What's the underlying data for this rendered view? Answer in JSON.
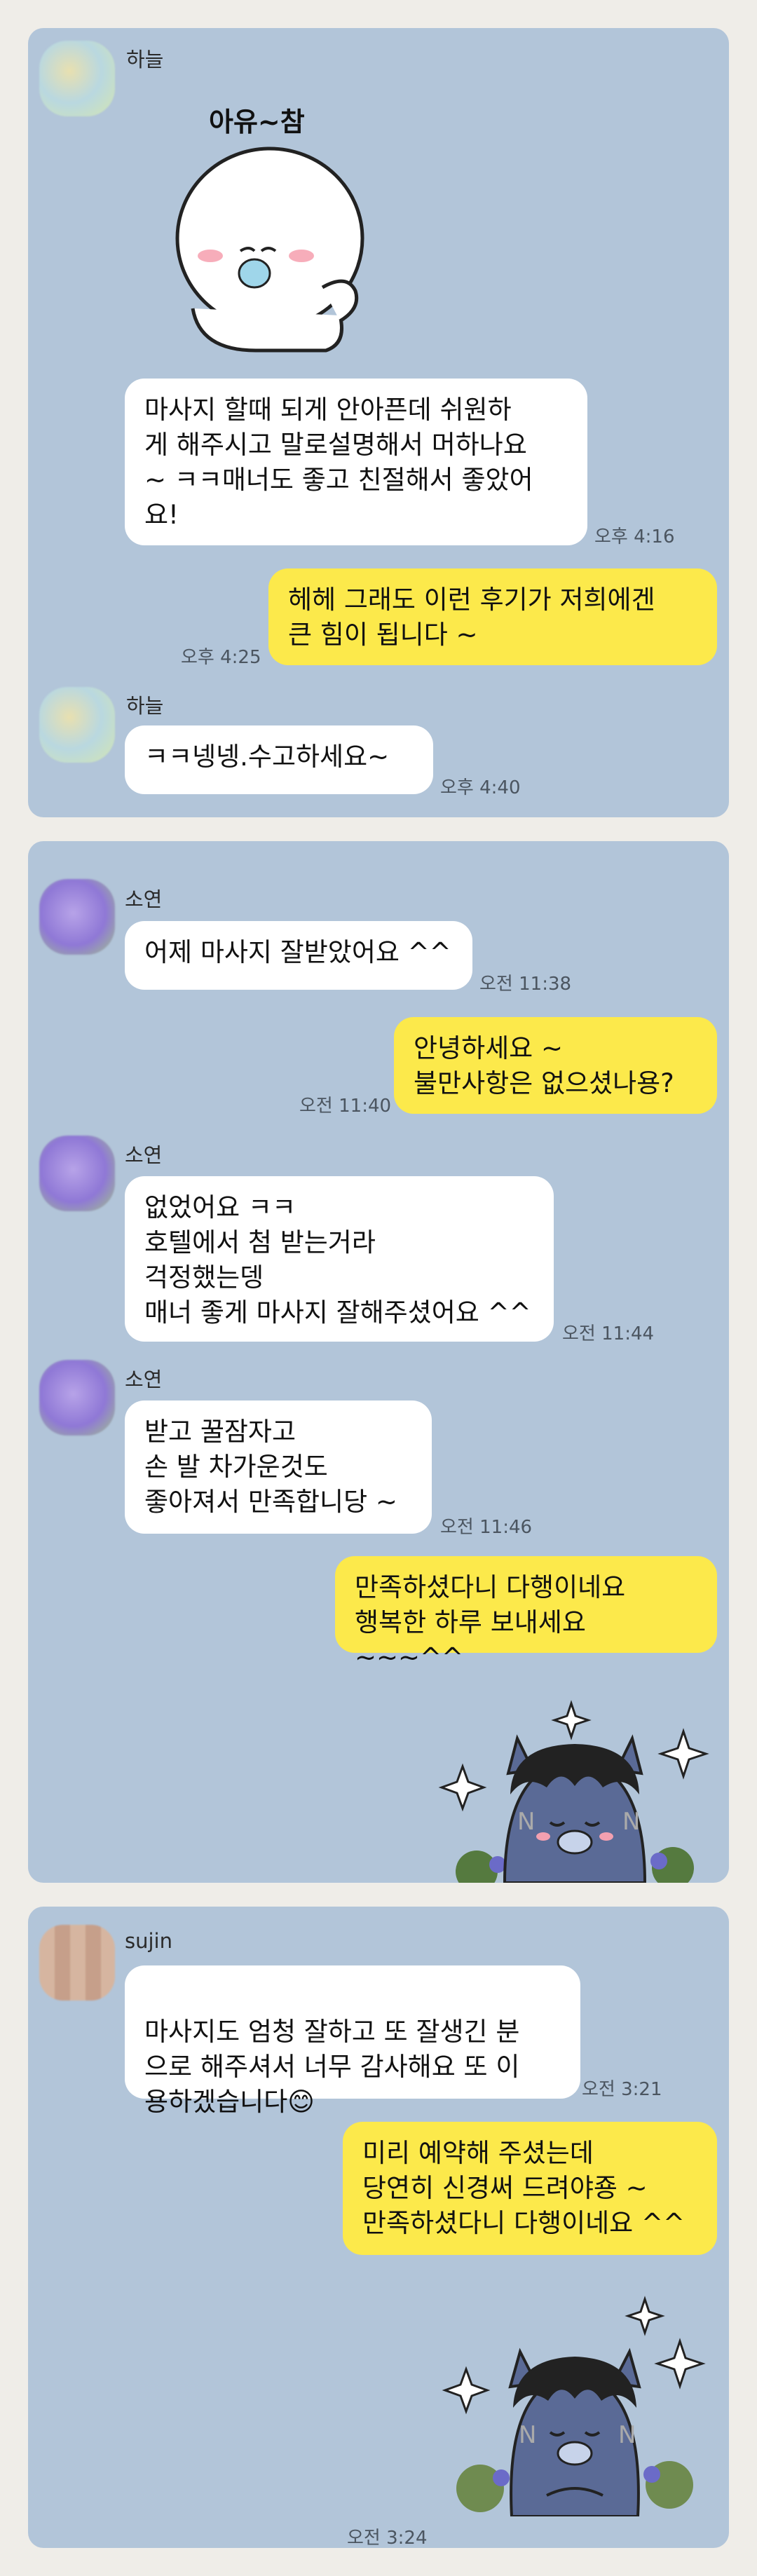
{
  "chats": [
    {
      "sender_a": "하늘",
      "sticker_caption": "아유~참",
      "msg1": "마사지 할때 되게 안아픈데 쉬원하\n게 해주시고 말로설명해서 머하나요\n~ ㅋㅋ매너도 좋고 친절해서 좋았어\n요!",
      "time1": "오후 4:16",
      "reply1": "헤헤 그래도 이런 후기가 저희에겐\n큰 힘이 됩니다 ~",
      "reply1_time": "오후 4:25",
      "sender_b": "하늘",
      "msg2": "ㅋㅋ넹넹.수고하세요~",
      "time2": "오후 4:40"
    },
    {
      "sender1": "소연",
      "msg1": "어제 마사지 잘받았어요 ^^",
      "time1": "오전 11:38",
      "reply1": "안녕하세요 ~\n불만사항은 없으셨나용?",
      "reply1_time": "오전 11:40",
      "sender2": "소연",
      "msg2": "없었어요 ㅋㅋ\n호텔에서 첨 받는거라\n걱정했는뎅\n매너 좋게 마사지 잘해주셨어요 ^^",
      "time2": "오전 11:44",
      "sender3": "소연",
      "msg3": "받고 꿀잠자고\n손 발 차가운것도\n좋아져서 만족합니당 ~",
      "time3": "오전 11:46",
      "reply2": "만족하셨다니 다행이네요\n행복한 하루 보내세요 ~~~^^"
    },
    {
      "sender1": "sujin",
      "msg1": "마사지도 엄청 잘하고 또 잘생긴 분\n으로 해주셔서 너무 감사해요 또 이\n용하겠습니다",
      "emoji": "😊",
      "time1": "오전 3:21",
      "reply1": "미리 예약해 주셨는데\n당연히 신경써 드려야죵 ~\n만족하셨다니 다행이네요 ^^",
      "reply1_time": "오전 3:24"
    }
  ],
  "colors": {
    "chat_bg": "#b2c5d9",
    "outgoing": "#fce94b",
    "incoming": "#ffffff",
    "page": "#efede8"
  },
  "icons": {
    "sticker1": "smiling-blob-sticker",
    "sticker2": "cat-character-sticker"
  }
}
